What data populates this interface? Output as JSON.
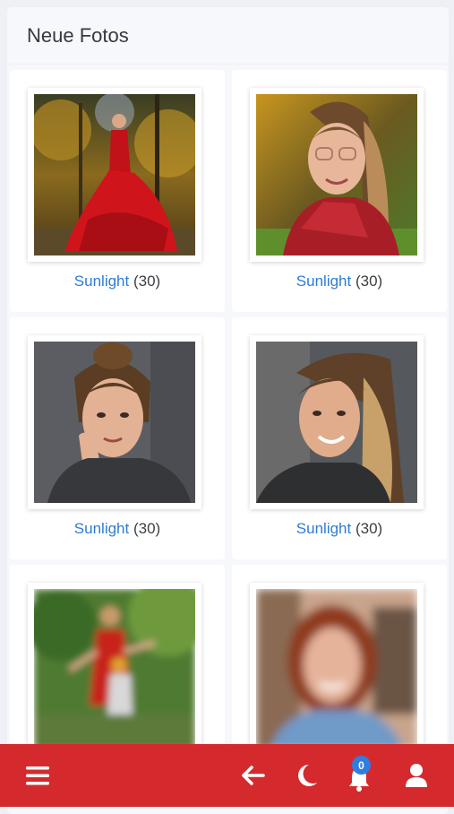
{
  "header": {
    "title": "Neue Fotos"
  },
  "photos": [
    {
      "album": "Sunlight",
      "count": "(30)",
      "subject": "woman in red dress autumn forest"
    },
    {
      "album": "Sunlight",
      "count": "(30)",
      "subject": "woman with glasses and red scarf autumn"
    },
    {
      "album": "Sunlight",
      "count": "(30)",
      "subject": "woman studio portrait hand on cheek"
    },
    {
      "album": "Sunlight",
      "count": "(30)",
      "subject": "woman smiling long hair studio"
    },
    {
      "album": "",
      "count": "",
      "subject": "blurred woman in red dress with child"
    },
    {
      "album": "",
      "count": "",
      "subject": "blurred red-haired woman portrait"
    }
  ],
  "bottom_bar": {
    "menu_icon": "hamburger-menu-icon",
    "back_icon": "arrow-left-icon",
    "theme_icon": "moon-icon",
    "notification_icon": "bell-icon",
    "notification_count": "0",
    "profile_icon": "user-icon"
  },
  "colors": {
    "accent": "#d42a2d",
    "link": "#2e7bd6",
    "badge": "#2f7de1"
  }
}
